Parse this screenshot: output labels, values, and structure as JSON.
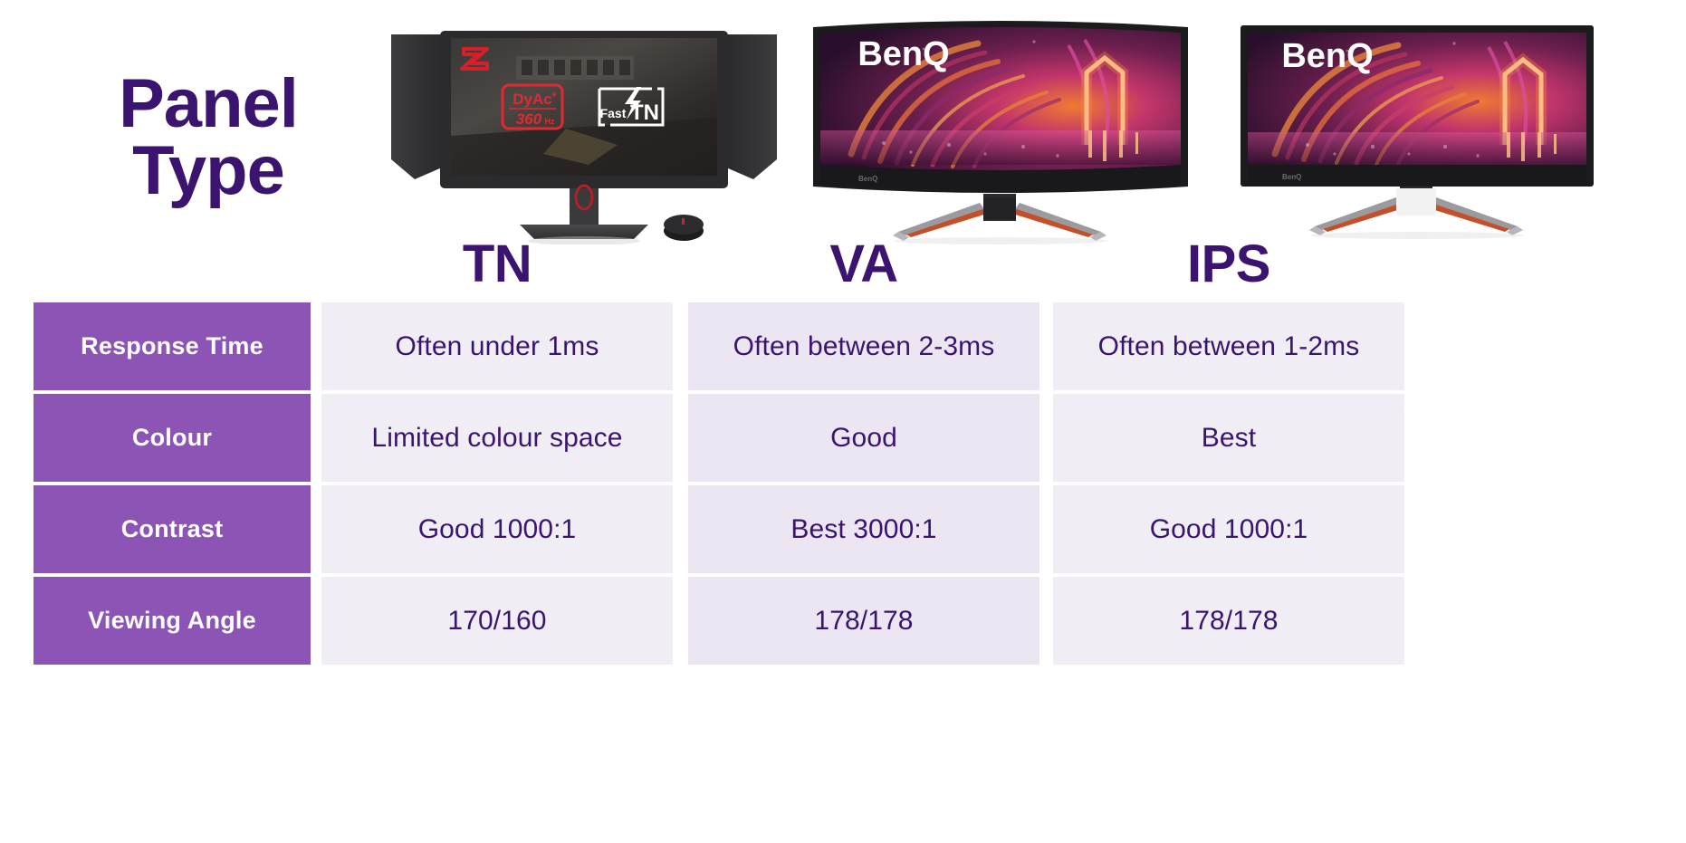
{
  "title": {
    "line1": "Panel",
    "line2": "Type"
  },
  "colors": {
    "title_purple": "#3B1470",
    "label_cell_purple": "#8B54B5",
    "value_cell_bg": "#F0EDF4",
    "value_cell_bg_alt": "#EBE6F1",
    "value_text": "#3B1470",
    "label_text": "#FFFFFF",
    "accent_red": "#E1261C",
    "stand_orange": "#C4502A"
  },
  "columns": [
    {
      "key": "tn",
      "header": "TN"
    },
    {
      "key": "va",
      "header": "VA"
    },
    {
      "key": "ips",
      "header": "IPS"
    }
  ],
  "monitors": {
    "tn": {
      "brand_logo": "zowie-logo",
      "badge_primary": "DyAc",
      "badge_primary_sup": "+",
      "badge_rate": "360",
      "badge_rate_unit": "Hz",
      "badge_secondary": "Fast TN",
      "has_side_shields": true,
      "has_puck": true,
      "curved": false
    },
    "va": {
      "brand_logo": "BenQ",
      "bezel_logo": "BenQ",
      "curved": true,
      "stand": "v-stand"
    },
    "ips": {
      "brand_logo": "BenQ",
      "bezel_logo": "BenQ",
      "curved": false,
      "stand": "v-stand"
    }
  },
  "rows": [
    {
      "label": "Response Time",
      "tn": "Often under 1ms",
      "va": "Often between 2-3ms",
      "ips": "Often between 1-2ms"
    },
    {
      "label": "Colour",
      "tn": "Limited colour space",
      "va": "Good",
      "ips": "Best"
    },
    {
      "label": "Contrast",
      "tn": "Good 1000:1",
      "va": "Best 3000:1",
      "ips": "Good 1000:1"
    },
    {
      "label": "Viewing Angle",
      "tn": "170/160",
      "va": "178/178",
      "ips": "178/178"
    }
  ]
}
